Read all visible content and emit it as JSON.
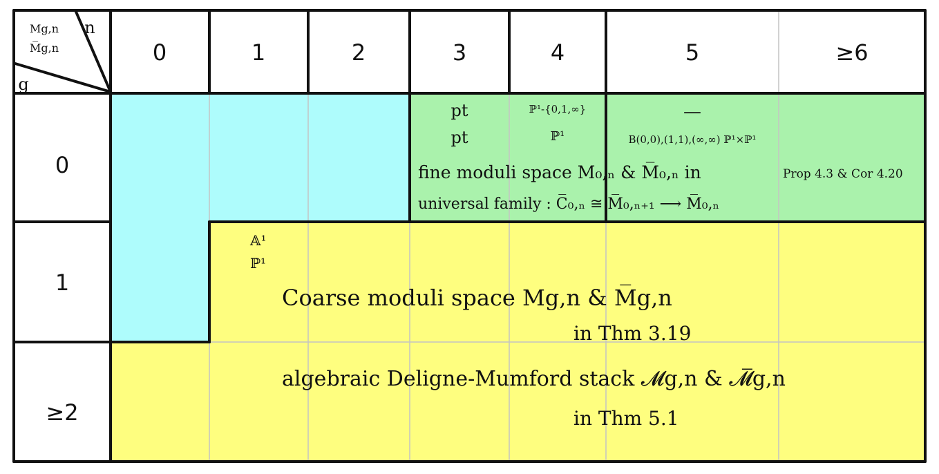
{
  "corner": {
    "col_var": "n",
    "row_var": "g",
    "spaces_top": "Mg,n",
    "spaces_bottom": "M̅g,n"
  },
  "columns": [
    "0",
    "1",
    "2",
    "3",
    "4",
    "5",
    "≥6"
  ],
  "rows": [
    "0",
    "1",
    "≥2"
  ],
  "colors": {
    "cyan": "#aefcfc",
    "green": "#aaf2ac",
    "yellow": "#fefe7f",
    "line": "#111111",
    "faint_line": "#bdbdbd"
  },
  "genus0": {
    "n3_top": "pt",
    "n3_bottom": "pt",
    "n4_top": "ℙ¹-{0,1,∞}",
    "n4_bottom": "ℙ¹",
    "n5_top": "—",
    "n5_bottom": "B(0,0),(1,1),(∞,∞) ℙ¹×ℙ¹",
    "fine_line_a": "fine moduli space M₀,ₙ & M̅₀,ₙ in",
    "fine_line_b": "Prop 4.3 & Cor 4.20",
    "universal": "universal family : C̅₀,ₙ ≅ M̅₀,ₙ₊₁ ⟶ M̅₀,ₙ"
  },
  "genus1": {
    "n1_top": "𝔸¹",
    "n1_bottom": "ℙ¹"
  },
  "coarse": {
    "line1": "Coarse moduli space Mg,n & M̅g,n",
    "line2": "in Thm 3.19"
  },
  "stack": {
    "line1": "algebraic Deligne-Mumford stack 𝓜g,n & 𝓜̅g,n",
    "line2": "in Thm 5.1"
  }
}
